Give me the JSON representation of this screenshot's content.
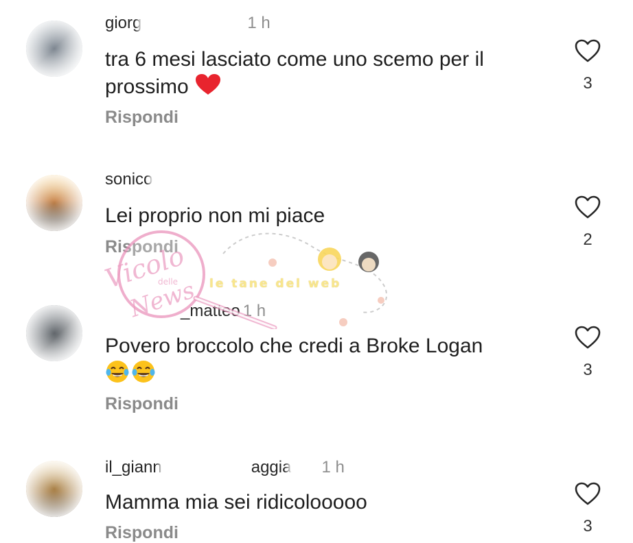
{
  "comments": [
    {
      "username": "giorg",
      "time": "1 h",
      "text": "tra 6 mesi lasciato come uno scemo per il prossimo",
      "emoji": "red-heart",
      "reply_label": "Rispondi",
      "likes": "3"
    },
    {
      "username": "sonico",
      "time": "",
      "text": "Lei proprio non mi piace",
      "emoji": "",
      "reply_label": "Rispondi",
      "likes": "2"
    },
    {
      "username": "_matteo",
      "time": "1 h",
      "text": "Povero broccolo che credi a Broke Logan",
      "emoji": "laughing-with-tears x2",
      "reply_label": "Rispondi",
      "likes": "3"
    },
    {
      "username": "il_giann",
      "username_tail": "aggia",
      "time": "1 h",
      "text": "Mamma mia sei ridicolooooo",
      "emoji": "",
      "reply_label": "Rispondi",
      "likes": "3"
    }
  ],
  "watermark": {
    "brand": "Vicolo delle News",
    "tagline": "le tane del web"
  },
  "icons": {
    "like": "heart-outline-icon"
  },
  "colors": {
    "text": "#1e1e1e",
    "muted": "#8a8a8a",
    "heart_red": "#e8242e",
    "watermark_pink": "#e98fb8"
  }
}
